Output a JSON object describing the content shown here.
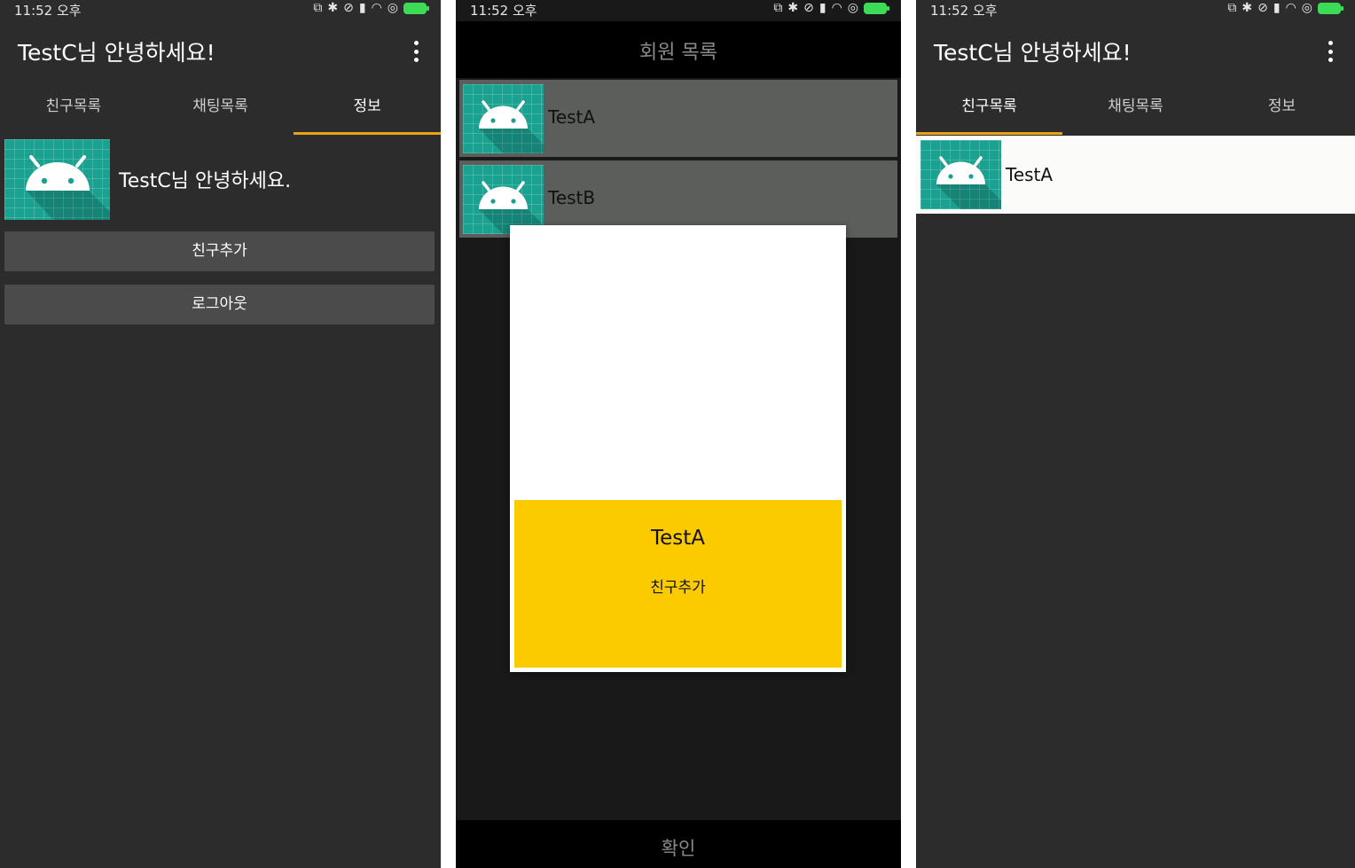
{
  "status_bar": {
    "time": "11:52 오후",
    "colors": {
      "battery": "#3ddc57"
    }
  },
  "panel_info": {
    "app_title": "TestC님 안녕하세요!",
    "tabs": [
      {
        "label": "친구목록",
        "active": false
      },
      {
        "label": "채팅목록",
        "active": false
      },
      {
        "label": "정보",
        "active": true
      }
    ],
    "profile": {
      "avatar_icon": "android-icon",
      "greeting": "TestC님 안녕하세요."
    },
    "buttons": {
      "add_friend": "친구추가",
      "logout": "로그아웃"
    }
  },
  "panel_members": {
    "title": "회원 목록",
    "members": [
      {
        "name": "TestA",
        "avatar_icon": "android-icon"
      },
      {
        "name": "TestB",
        "avatar_icon": "android-icon"
      }
    ],
    "dialog": {
      "name": "TestA",
      "action": "친구추가"
    },
    "confirm_label": "확인"
  },
  "panel_friends": {
    "app_title": "TestC님 안녕하세요!",
    "tabs": [
      {
        "label": "친구목록",
        "active": true
      },
      {
        "label": "채팅목록",
        "active": false
      },
      {
        "label": "정보",
        "active": false
      }
    ],
    "friends": [
      {
        "name": "TestA",
        "avatar_icon": "android-icon"
      }
    ]
  },
  "colors": {
    "tab_indicator": "#e8a317",
    "dialog_card": "#fbcb00",
    "avatar_bg": "#1aa190"
  }
}
